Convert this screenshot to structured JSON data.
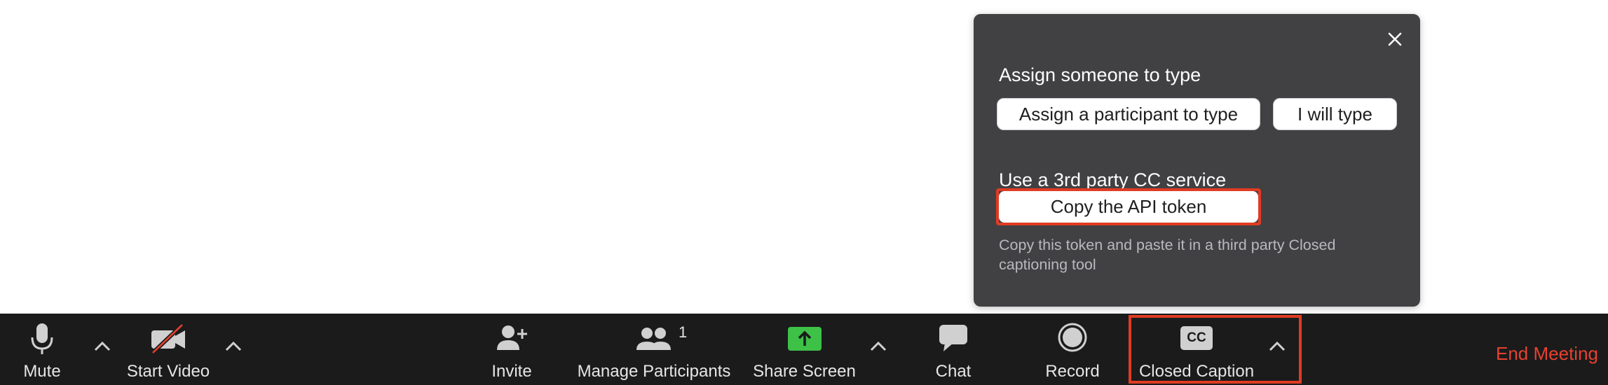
{
  "popup": {
    "assign_heading": "Assign someone to type",
    "assign_participant_label": "Assign a participant to type",
    "i_will_type_label": "I will type",
    "third_party_heading": "Use a 3rd party CC service",
    "copy_token_label": "Copy the API token",
    "description": "Copy this token and paste it in a third party Closed captioning tool"
  },
  "toolbar": {
    "mute_label": "Mute",
    "start_video_label": "Start Video",
    "invite_label": "Invite",
    "manage_participants_label": "Manage Participants",
    "participant_count": "1",
    "share_screen_label": "Share Screen",
    "chat_label": "Chat",
    "record_label": "Record",
    "cc_icon_text": "CC",
    "closed_caption_label": "Closed Caption",
    "end_meeting_label": "End Meeting"
  },
  "colors": {
    "toolbar_bg": "#1b1b1c",
    "popup_bg": "#414144",
    "highlight": "#e03b22",
    "end_meeting": "#e8412f",
    "share_green": "#3ec147"
  },
  "icons": [
    "close-icon",
    "microphone-icon",
    "video-off-icon",
    "add-person-icon",
    "participants-icon",
    "share-screen-icon",
    "chat-icon",
    "record-icon",
    "closed-caption-icon",
    "caret-up-icon"
  ]
}
